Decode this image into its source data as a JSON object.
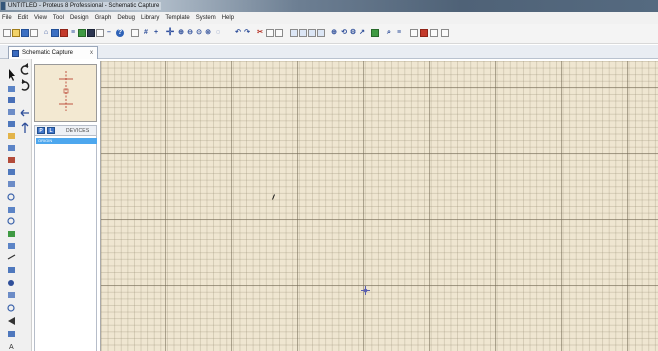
{
  "window": {
    "title": "UNTITLED - Proteus 8 Professional - Schematic Capture"
  },
  "menu": {
    "items": [
      "File",
      "Edit",
      "View",
      "Tool",
      "Design",
      "Graph",
      "Debug",
      "Library",
      "Template",
      "System",
      "Help"
    ]
  },
  "toolbar": {
    "icons": [
      "new-icon",
      "open-icon",
      "save-icon",
      "import-icon",
      "home-icon",
      "schematic-icon",
      "pcb-icon",
      "gerber-icon",
      "bom-icon",
      "3d-icon",
      "help-icon",
      "refresh-icon",
      "grid-icon",
      "origin-icon",
      "pan-icon",
      "zoom-in-icon",
      "zoom-out-icon",
      "zoom-all-icon",
      "zoom-area-icon",
      "undo-icon",
      "redo-icon",
      "cut-icon",
      "copy-icon",
      "paste-icon",
      "block-copy-icon",
      "block-move-icon",
      "block-rotate-icon",
      "block-delete-icon",
      "pick-device-icon",
      "make-device-icon",
      "packaging-icon",
      "decompose-icon",
      "wire-autorouter-icon",
      "search-icon",
      "property-assignment-icon",
      "design-explorer-icon",
      "new-sheet-icon",
      "remove-sheet-icon",
      "exit-to-parent-icon"
    ]
  },
  "tabs": [
    {
      "label": "Schematic Capture",
      "close": "x"
    }
  ],
  "devices": {
    "pick_button": "P",
    "library_button": "L",
    "header": "DEVICES",
    "selected": "ORIGIN"
  },
  "colors": {
    "canvas": "#efe6d1",
    "preview": "#f3e9d2",
    "accent": "#3b6fc2",
    "selection": "#4da7ee"
  }
}
